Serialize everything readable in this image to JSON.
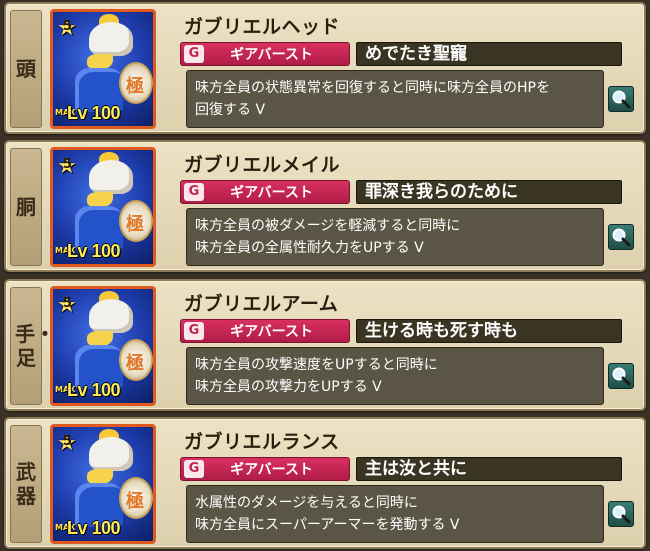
{
  "equipment": [
    {
      "slot": "頭",
      "rarity_star": "5",
      "level_max_label": "MAX",
      "level_label": "Lv 100",
      "gear_name": "ガブリエルヘッド",
      "skill_type_icon": "G",
      "skill_type": "ギアバースト",
      "skill_name": "めでたき聖寵",
      "description": "味方全員の状態異常を回復すると同時に味方全員のHPを\n回復する Ⅴ"
    },
    {
      "slot": "胴",
      "rarity_star": "5",
      "level_max_label": "MAX",
      "level_label": "Lv 100",
      "gear_name": "ガブリエルメイル",
      "skill_type_icon": "G",
      "skill_type": "ギアバースト",
      "skill_name": "罪深き我らのために",
      "description": "味方全員の被ダメージを軽減すると同時に\n味方全員の全属性耐久力をUPする Ⅴ"
    },
    {
      "slot": "手・足",
      "rarity_star": "5",
      "level_max_label": "MAX",
      "level_label": "Lv 100",
      "gear_name": "ガブリエルアーム",
      "skill_type_icon": "G",
      "skill_type": "ギアバースト",
      "skill_name": "生ける時も死す時も",
      "description": "味方全員の攻撃速度をUPすると同時に\n味方全員の攻撃力をUPする Ⅴ"
    },
    {
      "slot": "武器",
      "rarity_star": "5",
      "level_max_label": "MAX",
      "level_label": "Lv 100",
      "gear_name": "ガブリエルランス",
      "skill_type_icon": "G",
      "skill_type": "ギアバースト",
      "skill_name": "主は汝と共に",
      "description": "水属性のダメージを与えると同時に\n味方全員にスーパーアーマーを発動する Ⅴ"
    }
  ],
  "icons": {
    "zoom": "magnifier-icon",
    "gear_burst": "gear-burst-icon",
    "rarity": "star-icon"
  },
  "colors": {
    "panel_bg": "#e4d8b8",
    "skill_type_bg": "#c4264f",
    "skill_name_bg": "#3a3422",
    "desc_bg": "#5b5545",
    "portrait_border": "#e05a1f",
    "level_text": "#ffec5a"
  }
}
